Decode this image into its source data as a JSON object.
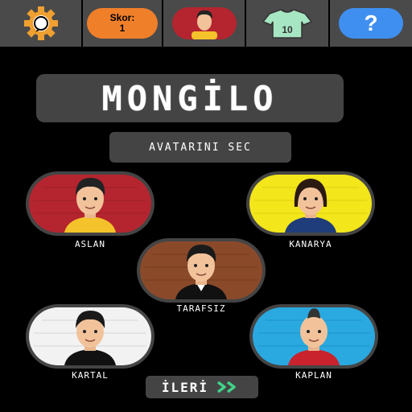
{
  "topbar": {
    "settings_icon": "gear-icon",
    "score_label": "Skor:",
    "score_value": "1",
    "avatar_icon": "player-avatar-icon",
    "jersey_icon": "jersey-icon",
    "jersey_number": "10",
    "help_label": "?"
  },
  "title": "MONGİLO",
  "choose_label": "AVATARINI SEC",
  "avatars": [
    {
      "name": "ASLAN",
      "bg": "#b5252f",
      "shirt": "#f4c22a"
    },
    {
      "name": "KANARYA",
      "bg": "#f3e61a",
      "shirt": "#1f3d7a"
    },
    {
      "name": "TARAFSIZ",
      "bg": "#8a4a2a",
      "shirt": "#111111"
    },
    {
      "name": "KARTAL",
      "bg": "#f2f2f2",
      "shirt": "#111111"
    },
    {
      "name": "KAPLAN",
      "bg": "#2aa9e0",
      "shirt": "#c9232d"
    }
  ],
  "next_label": "İLERİ",
  "colors": {
    "panel": "#444444",
    "tile": "#4a4a4a",
    "score": "#f07f2a",
    "help": "#3f8ff0",
    "arrow": "#3fd28a"
  }
}
